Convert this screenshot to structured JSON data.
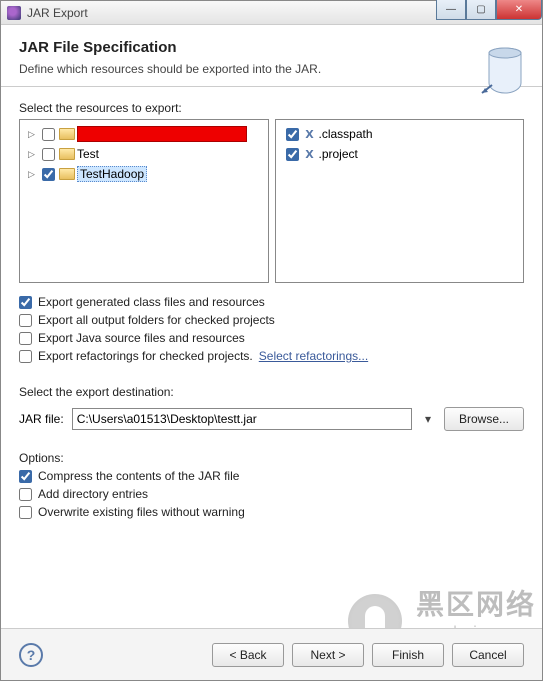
{
  "window": {
    "title": "JAR Export"
  },
  "header": {
    "title": "JAR File Specification",
    "subtitle": "Define which resources should be exported into the JAR."
  },
  "resources": {
    "label": "Select the resources to export:",
    "left_tree": [
      {
        "checked": false,
        "label": "[redacted]",
        "expander": "▷",
        "redacted": true,
        "selected": false
      },
      {
        "checked": false,
        "label": "Test",
        "expander": "▷",
        "redacted": false,
        "selected": false
      },
      {
        "checked": true,
        "label": "TestHadoop",
        "expander": "▷",
        "redacted": false,
        "selected": true
      }
    ],
    "right_list": [
      {
        "checked": true,
        "label": ".classpath"
      },
      {
        "checked": true,
        "label": ".project"
      }
    ]
  },
  "export_options": [
    {
      "checked": true,
      "label": "Export generated class files and resources"
    },
    {
      "checked": false,
      "label": "Export all output folders for checked projects"
    },
    {
      "checked": false,
      "label": "Export Java source files and resources"
    },
    {
      "checked": false,
      "label": "Export refactorings for checked projects.",
      "link": "Select refactorings..."
    }
  ],
  "destination": {
    "section_label": "Select the export destination:",
    "field_label": "JAR file:",
    "value": "C:\\Users\\a01513\\Desktop\\testt.jar",
    "browse": "Browse..."
  },
  "options": {
    "section_label": "Options:",
    "items": [
      {
        "checked": true,
        "label": "Compress the contents of the JAR file"
      },
      {
        "checked": false,
        "label": "Add directory entries"
      },
      {
        "checked": false,
        "label": "Overwrite existing files without warning"
      }
    ]
  },
  "footer": {
    "back": "< Back",
    "next": "Next >",
    "finish": "Finish",
    "cancel": "Cancel"
  },
  "watermark": {
    "cn": "黑区网络",
    "url": "www.heiqu.com"
  }
}
